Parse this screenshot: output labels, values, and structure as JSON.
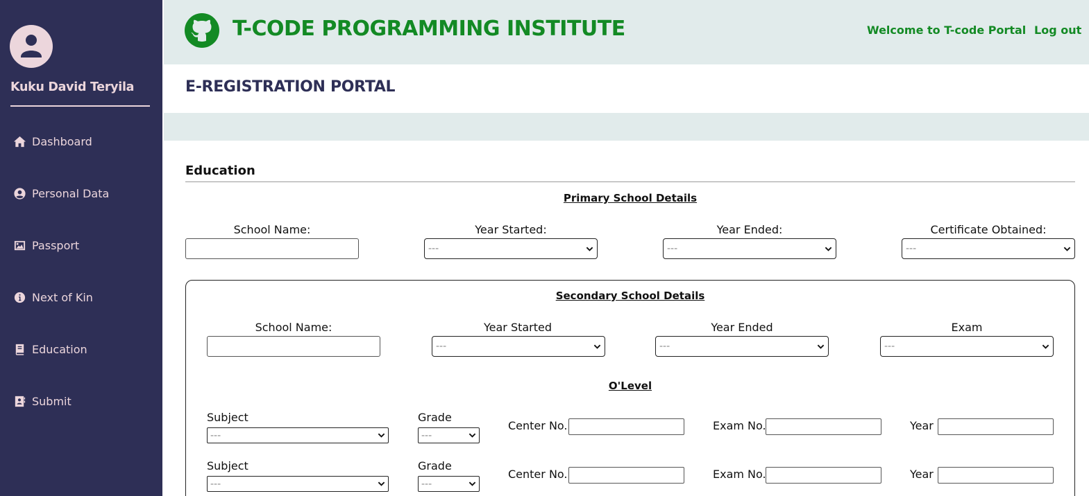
{
  "user": {
    "name": "Kuku David Teryila"
  },
  "sidebar": {
    "items": [
      {
        "label": "Dashboard",
        "icon": "home-icon"
      },
      {
        "label": "Personal Data",
        "icon": "user-circle-icon"
      },
      {
        "label": "Passport",
        "icon": "image-icon"
      },
      {
        "label": "Next of Kin",
        "icon": "info-icon"
      },
      {
        "label": "Education",
        "icon": "book-icon"
      },
      {
        "label": "Submit",
        "icon": "address-book-icon"
      }
    ]
  },
  "header": {
    "brand": "T-CODE PROGRAMMING INSTITUTE",
    "welcome": "Welcome to T-code Portal",
    "logout": "Log out"
  },
  "portal_title": "E-REGISTRATION PORTAL",
  "section_title": "Education",
  "primary": {
    "heading": "Primary School Details",
    "school_name_label": "School Name:",
    "year_started_label": "Year Started:",
    "year_ended_label": "Year Ended:",
    "certificate_label": "Certificate Obtained:",
    "year_started_value": "---",
    "year_ended_value": "---",
    "certificate_value": "---"
  },
  "secondary": {
    "heading": "Secondary School Details",
    "school_name_label": "School Name:",
    "year_started_label": "Year Started",
    "year_ended_label": "Year Ended",
    "exam_label": "Exam",
    "year_started_value": "---",
    "year_ended_value": "---",
    "exam_value": "---"
  },
  "olevel": {
    "heading": "O'Level",
    "subject_label": "Subject",
    "grade_label": "Grade",
    "center_label": "Center No.",
    "exam_no_label": "Exam No.",
    "year_label": "Year",
    "rows": [
      {
        "subject": "---",
        "grade": "---"
      },
      {
        "subject": "---",
        "grade": "---"
      }
    ]
  },
  "colors": {
    "sidebar_bg": "#2e2f56",
    "sidebar_text": "#ecd6dc",
    "header_bg": "#e1ebeb",
    "brand_green": "#138a24",
    "title_navy": "#2e2f56"
  }
}
